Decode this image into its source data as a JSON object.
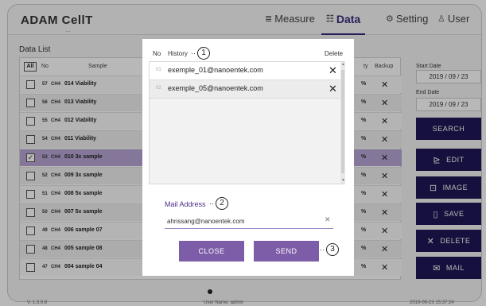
{
  "app": {
    "title": "ADAM CellT",
    "title_sub": "..."
  },
  "nav": [
    {
      "label": "Measure",
      "icon": "≣"
    },
    {
      "label": "Data",
      "icon": "☷"
    },
    {
      "label": "Setting",
      "icon": "⚙"
    },
    {
      "label": "User",
      "icon": "♙"
    }
  ],
  "data_list": {
    "title": "Data List",
    "all_label": "All",
    "headers": {
      "no": "No",
      "sample": "Sample",
      "viability": "ty",
      "backup": "Backup"
    },
    "rows": [
      {
        "no": "57",
        "ch": "CH4",
        "name": "014 Viability",
        "pct": "%",
        "x": "✕",
        "check": ""
      },
      {
        "no": "56",
        "ch": "CH4",
        "name": "013 Viability",
        "pct": "%",
        "x": "✕",
        "check": ""
      },
      {
        "no": "55",
        "ch": "CH4",
        "name": "012 Viability",
        "pct": "%",
        "x": "✕",
        "check": ""
      },
      {
        "no": "54",
        "ch": "CH4",
        "name": "011 Viability",
        "pct": "%",
        "x": "✕",
        "check": ""
      },
      {
        "no": "53",
        "ch": "CH4",
        "name": "010 3x sample",
        "pct": "%",
        "x": "✕",
        "check": "✓"
      },
      {
        "no": "52",
        "ch": "CH4",
        "name": "009 3x sample",
        "pct": "%",
        "x": "✕",
        "check": ""
      },
      {
        "no": "51",
        "ch": "CH4",
        "name": "008 5x sample",
        "pct": "%",
        "x": "✕",
        "check": ""
      },
      {
        "no": "50",
        "ch": "CH4",
        "name": "007 5x sample",
        "pct": "%",
        "x": "✕",
        "check": ""
      },
      {
        "no": "49",
        "ch": "CH4",
        "name": "006 sample 07",
        "pct": "%",
        "x": "✕",
        "check": ""
      },
      {
        "no": "48",
        "ch": "CH4",
        "name": "005 sample 08",
        "pct": "%",
        "x": "✕",
        "check": ""
      },
      {
        "no": "47",
        "ch": "CH4",
        "name": "004 sample 04",
        "pct": "%",
        "x": "✕",
        "check": ""
      }
    ]
  },
  "sidebar": {
    "start_label": "Start Date",
    "start_value": "2019 / 09 / 23",
    "end_label": "End Date",
    "end_value": "2019 / 09 / 23",
    "buttons": [
      {
        "label": "SEARCH",
        "icon": ""
      },
      {
        "label": "EDIT",
        "icon": "⊵"
      },
      {
        "label": "IMAGE",
        "icon": "⊡"
      },
      {
        "label": "SAVE",
        "icon": "▯"
      },
      {
        "label": "DELETE",
        "icon": "✕"
      },
      {
        "label": "MAIL",
        "icon": "✉"
      }
    ]
  },
  "footer": {
    "version": "V. 1.3.0.8",
    "user": "User Name: admin",
    "time": "2019-09-23 15:37:24"
  },
  "modal": {
    "col_no": "No",
    "col_history": "History",
    "col_delete": "Delete",
    "callout_dots": "··",
    "callout_1": "1",
    "callout_2": "2",
    "callout_3": "3",
    "history": [
      {
        "no": "01",
        "email": "exemple_01@nanoentek.com",
        "delete": "✕"
      },
      {
        "no": "02",
        "email": "exemple_05@nanoentek.com",
        "delete": "✕"
      }
    ],
    "mail_label": "Mail Address",
    "mail_value": "ahnssang@nanoentek.com",
    "clear_icon": "✕",
    "close_label": "CLOSE",
    "send_label": "SEND"
  },
  "colors": {
    "nav_active": "#3a2a7c",
    "sidebar_button": "#1e1755",
    "modal_button": "#7d5ca8",
    "selected_row": "#b8a6d6"
  }
}
